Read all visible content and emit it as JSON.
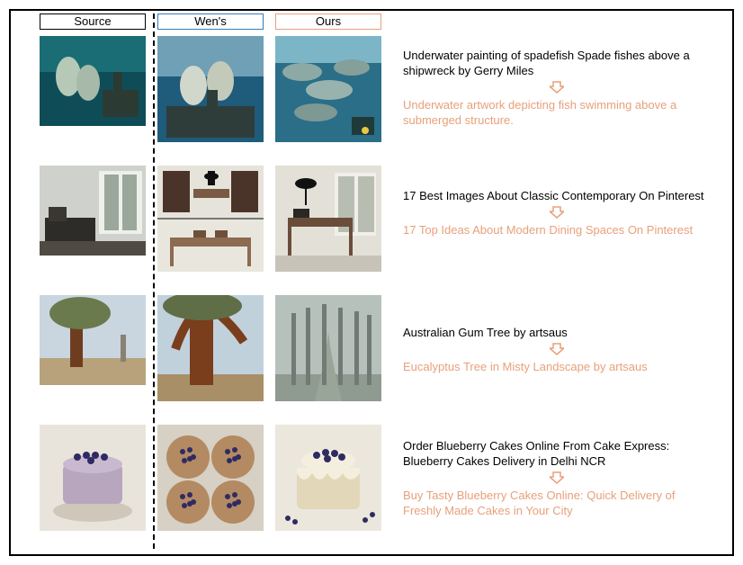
{
  "headers": {
    "source": "Source",
    "wen": "Wen's",
    "ours": "Ours"
  },
  "rows": [
    {
      "original": "Underwater painting of spadefish Spade fishes above a shipwreck by Gerry Miles",
      "transformed": "Underwater artwork depicting fish swimming above a submerged structure."
    },
    {
      "original": "17 Best Images About Classic Contemporary On Pinterest",
      "transformed": "17 Top Ideas About Modern Dining Spaces On Pinterest"
    },
    {
      "original": "Australian Gum Tree by artsaus",
      "transformed": "Eucalyptus Tree in Misty Landscape by artsaus"
    },
    {
      "original": "Order Blueberry Cakes Online From Cake Express: Blueberry Cakes Delivery in Delhi NCR",
      "transformed": "Buy Tasty Blueberry Cakes Online: Quick Delivery of Freshly Made Cakes in Your City"
    }
  ]
}
